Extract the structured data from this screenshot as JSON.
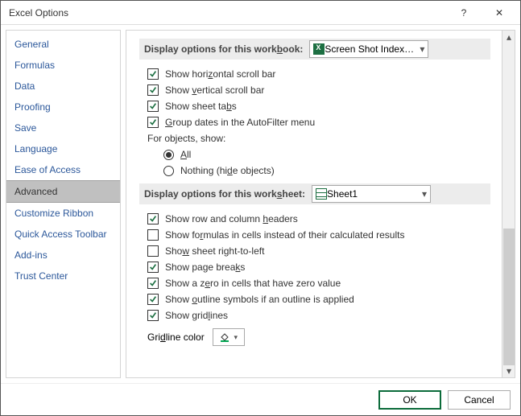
{
  "window": {
    "title": "Excel Options",
    "help_glyph": "?",
    "close_glyph": "✕"
  },
  "sidebar": {
    "items": [
      {
        "label": "General"
      },
      {
        "label": "Formulas"
      },
      {
        "label": "Data"
      },
      {
        "label": "Proofing"
      },
      {
        "label": "Save"
      },
      {
        "label": "Language"
      },
      {
        "label": "Ease of Access"
      },
      {
        "label": "Advanced"
      },
      {
        "label": "Customize Ribbon"
      },
      {
        "label": "Quick Access Toolbar"
      },
      {
        "label": "Add-ins"
      },
      {
        "label": "Trust Center"
      }
    ],
    "selected_index": 7
  },
  "sections": {
    "workbook": {
      "header_prefix": "Display options for this work",
      "header_key": "b",
      "header_suffix": "ook:",
      "combo_value": "Screen Shot Index.x…",
      "options": {
        "horizontal_scroll": {
          "checked": true,
          "pre": "Show hori",
          "key": "z",
          "post": "ontal scroll bar"
        },
        "vertical_scroll": {
          "checked": true,
          "pre": "Show ",
          "key": "v",
          "post": "ertical scroll bar"
        },
        "sheet_tabs": {
          "checked": true,
          "pre": "Show sheet ta",
          "key": "b",
          "post": "s"
        },
        "group_dates": {
          "checked": true,
          "pre": "",
          "key": "G",
          "post": "roup dates in the AutoFilter menu"
        },
        "for_objects_label": "For objects, show:",
        "radio_all": {
          "selected": true,
          "pre": "",
          "key": "A",
          "post": "ll"
        },
        "radio_nothing": {
          "selected": false,
          "pre": "Nothing (hi",
          "key": "d",
          "post": "e objects)"
        }
      }
    },
    "worksheet": {
      "header_prefix": "Display options for this work",
      "header_key": "s",
      "header_suffix": "heet:",
      "combo_value": "Sheet1",
      "options": {
        "row_col_headers": {
          "checked": true,
          "pre": "Show row and column ",
          "key": "h",
          "post": "eaders"
        },
        "show_formulas": {
          "checked": false,
          "pre": "Show fo",
          "key": "r",
          "post": "mulas in cells instead of their calculated results"
        },
        "rtl": {
          "checked": false,
          "pre": "Sho",
          "key": "w",
          "post": " sheet right-to-left"
        },
        "page_breaks": {
          "checked": true,
          "pre": "Show page brea",
          "key": "k",
          "post": "s"
        },
        "zero_values": {
          "checked": true,
          "pre": "Show a z",
          "key": "e",
          "post": "ro in cells that have zero value"
        },
        "outline_symbols": {
          "checked": true,
          "pre": "Show ",
          "key": "o",
          "post": "utline symbols if an outline is applied"
        },
        "gridlines": {
          "checked": true,
          "pre": "Show grid",
          "key": "l",
          "post": "ines"
        },
        "gridline_color_pre": "Gri",
        "gridline_color_key": "d",
        "gridline_color_post": "line color"
      }
    }
  },
  "footer": {
    "ok": "OK",
    "cancel": "Cancel"
  },
  "scroll_glyph_up": "▴",
  "scroll_glyph_down": "▾",
  "caret_glyph": "▾"
}
